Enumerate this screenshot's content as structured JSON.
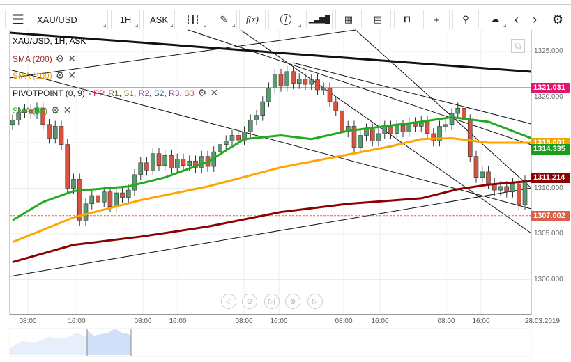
{
  "toolbar": {
    "symbol": "XAU/USD",
    "timeframe": "1H",
    "price_type": "ASK",
    "icons": [
      "menu-icon",
      "candles-icon",
      "pencil-icon",
      "function-icon",
      "info-icon",
      "bars-icon",
      "calendar-icon",
      "news-icon",
      "lock-icon",
      "crosshair-icon",
      "zoom-search-icon",
      "cloud-upload-icon",
      "cloud-download-icon",
      "chevron-left-icon",
      "chevron-right-icon",
      "gear-icon"
    ],
    "fx_label": "f(x)",
    "info_label": "i"
  },
  "legend": {
    "title": "XAU/USD, 1H, ASK",
    "sma200": "SMA (200)",
    "sma100": "SMA (100)",
    "sma55": "SMA (55)",
    "pivot_prefix": "PIVOTPOINT (0, 9)",
    "pivot_sep": " - ",
    "pivot_items": [
      {
        "t": "PP",
        "c": "#e0197a"
      },
      {
        "t": "R1",
        "c": "#556b2f"
      },
      {
        "t": "S1",
        "c": "#8a8a00"
      },
      {
        "t": "R2",
        "c": "#8e44ad"
      },
      {
        "t": "S2",
        "c": "#1f6f8b"
      },
      {
        "t": "R3",
        "c": "#8e3a9d"
      },
      {
        "t": "S3",
        "c": "#d9534f"
      }
    ]
  },
  "price_axis": {
    "ticks": [
      "1325.000",
      "1320.000",
      "1315.000",
      "1310.000",
      "1305.000",
      "1300.000"
    ],
    "tick_values": [
      1325,
      1320,
      1315,
      1310,
      1305,
      1300
    ]
  },
  "tags": [
    {
      "v": "1321.031",
      "price": 1321.031,
      "color": "#e0196e"
    },
    {
      "v": "1315.001",
      "price": 1315.001,
      "color": "#f5a300"
    },
    {
      "v": "1314.335",
      "price": 1314.335,
      "color": "#1a9e1a"
    },
    {
      "v": "1311.214",
      "price": 1311.214,
      "color": "#8b0000"
    },
    {
      "v": "1307.002",
      "price": 1307.002,
      "color": "#d9604c"
    }
  ],
  "time_axis": [
    "08:00",
    "16:00",
    "08:00",
    "16:00",
    "08:00",
    "16:00",
    "08:00",
    "16:00",
    "08:00",
    "16:00",
    "28.03.2019"
  ],
  "colors": {
    "bull": "#5a9a72",
    "bear": "#d9533f",
    "sma200": "#8b0000",
    "sma100": "#ffa500",
    "sma55": "#22aa22",
    "pivot": "#e0196e"
  },
  "candles_close": [
    1317.5,
    1318.3,
    1318.6,
    1318.2,
    1318.8,
    1317.0,
    1315.5,
    1316.8,
    1314.8,
    1310.0,
    1311.0,
    1306.5,
    1308.3,
    1309.2,
    1308.5,
    1309.6,
    1308.0,
    1309.5,
    1309.0,
    1309.8,
    1311.5,
    1312.8,
    1312.0,
    1313.8,
    1312.5,
    1313.6,
    1312.2,
    1313.2,
    1312.5,
    1313.0,
    1312.3,
    1313.5,
    1312.4,
    1314.0,
    1314.8,
    1315.2,
    1315.8,
    1315.3,
    1316.2,
    1317.5,
    1318.0,
    1319.5,
    1321.0,
    1322.5,
    1321.2,
    1322.8,
    1321.5,
    1322.0,
    1321.4,
    1321.9,
    1320.8,
    1321.0,
    1319.5,
    1318.5,
    1316.2,
    1316.8,
    1314.5,
    1315.8,
    1316.5,
    1315.2,
    1316.0,
    1316.8,
    1316.0,
    1316.9,
    1316.2,
    1317.2,
    1316.8,
    1317.3,
    1316.0,
    1315.2,
    1316.8,
    1317.0,
    1318.2,
    1318.8,
    1317.5,
    1313.5,
    1311.2,
    1311.8,
    1310.5,
    1309.8,
    1310.2,
    1309.6,
    1310.5,
    1308.2,
    1310.8
  ],
  "sma200": [
    [
      0,
      1301.9
    ],
    [
      10,
      1303.8
    ],
    [
      21,
      1304.7
    ],
    [
      32,
      1305.8
    ],
    [
      44,
      1307.4
    ],
    [
      55,
      1308.3
    ],
    [
      67,
      1308.9
    ],
    [
      73,
      1309.9
    ],
    [
      78,
      1310.4
    ],
    [
      85,
      1310.8
    ]
  ],
  "sma100": [
    [
      0,
      1304.1
    ],
    [
      10,
      1306.8
    ],
    [
      21,
      1308.7
    ],
    [
      32,
      1310.2
    ],
    [
      44,
      1312.3
    ],
    [
      55,
      1313.7
    ],
    [
      62,
      1314.6
    ],
    [
      67,
      1315.4
    ],
    [
      72,
      1315.5
    ],
    [
      78,
      1315.0
    ],
    [
      85,
      1315.0
    ]
  ],
  "sma55": [
    [
      0,
      1306.5
    ],
    [
      5,
      1308.5
    ],
    [
      10,
      1309.7
    ],
    [
      19,
      1310.2
    ],
    [
      25,
      1311.2
    ],
    [
      32,
      1312.9
    ],
    [
      38,
      1315.4
    ],
    [
      44,
      1315.8
    ],
    [
      49,
      1315.4
    ],
    [
      55,
      1316.3
    ],
    [
      61,
      1316.8
    ],
    [
      67,
      1317.3
    ],
    [
      72,
      1317.8
    ],
    [
      78,
      1317.3
    ],
    [
      85,
      1315.5
    ]
  ],
  "pivot_level": 1321.031,
  "last_price": 1307.002
}
